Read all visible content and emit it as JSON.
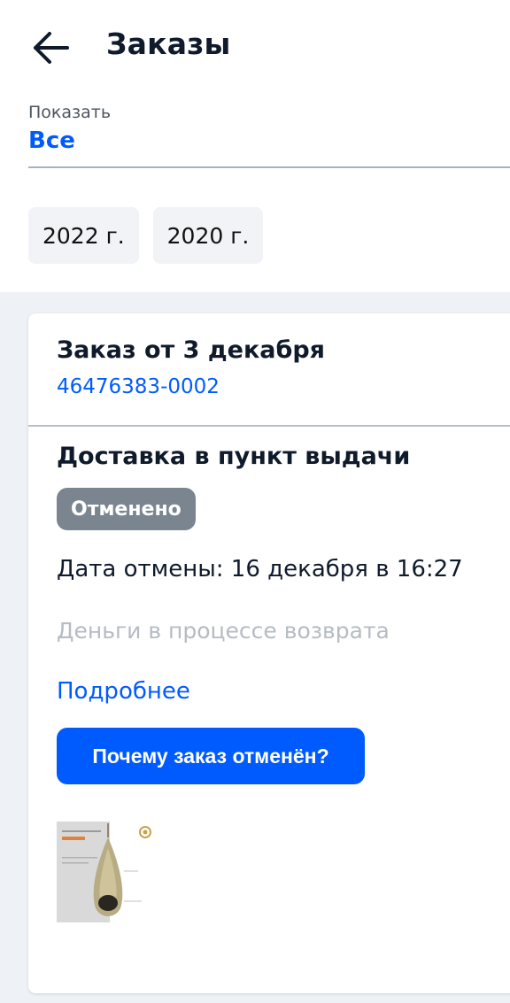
{
  "header": {
    "title": "Заказы",
    "back_icon": "arrow-left-icon"
  },
  "filter": {
    "label": "Показать",
    "value": "Все"
  },
  "years": [
    "2022 г.",
    "2020 г."
  ],
  "order": {
    "title": "Заказ от 3 декабря",
    "number": "46476383-0002",
    "delivery_type": "Доставка в пункт выдачи",
    "status": "Отменено",
    "cancel_date": "Дата отмены: 16 декабря в 16:27",
    "refund_status": "Деньги в процессе возврата",
    "details_link": "Подробнее",
    "why_button": "Почему заказ отменён?",
    "product_image": "hanging-pod-chair-product-thumbnail"
  },
  "colors": {
    "accent": "#005bff",
    "badge_gray": "#7a858f",
    "muted_text": "#b5bcc4",
    "background": "#eef1f5",
    "chip": "#f1f3f6"
  }
}
